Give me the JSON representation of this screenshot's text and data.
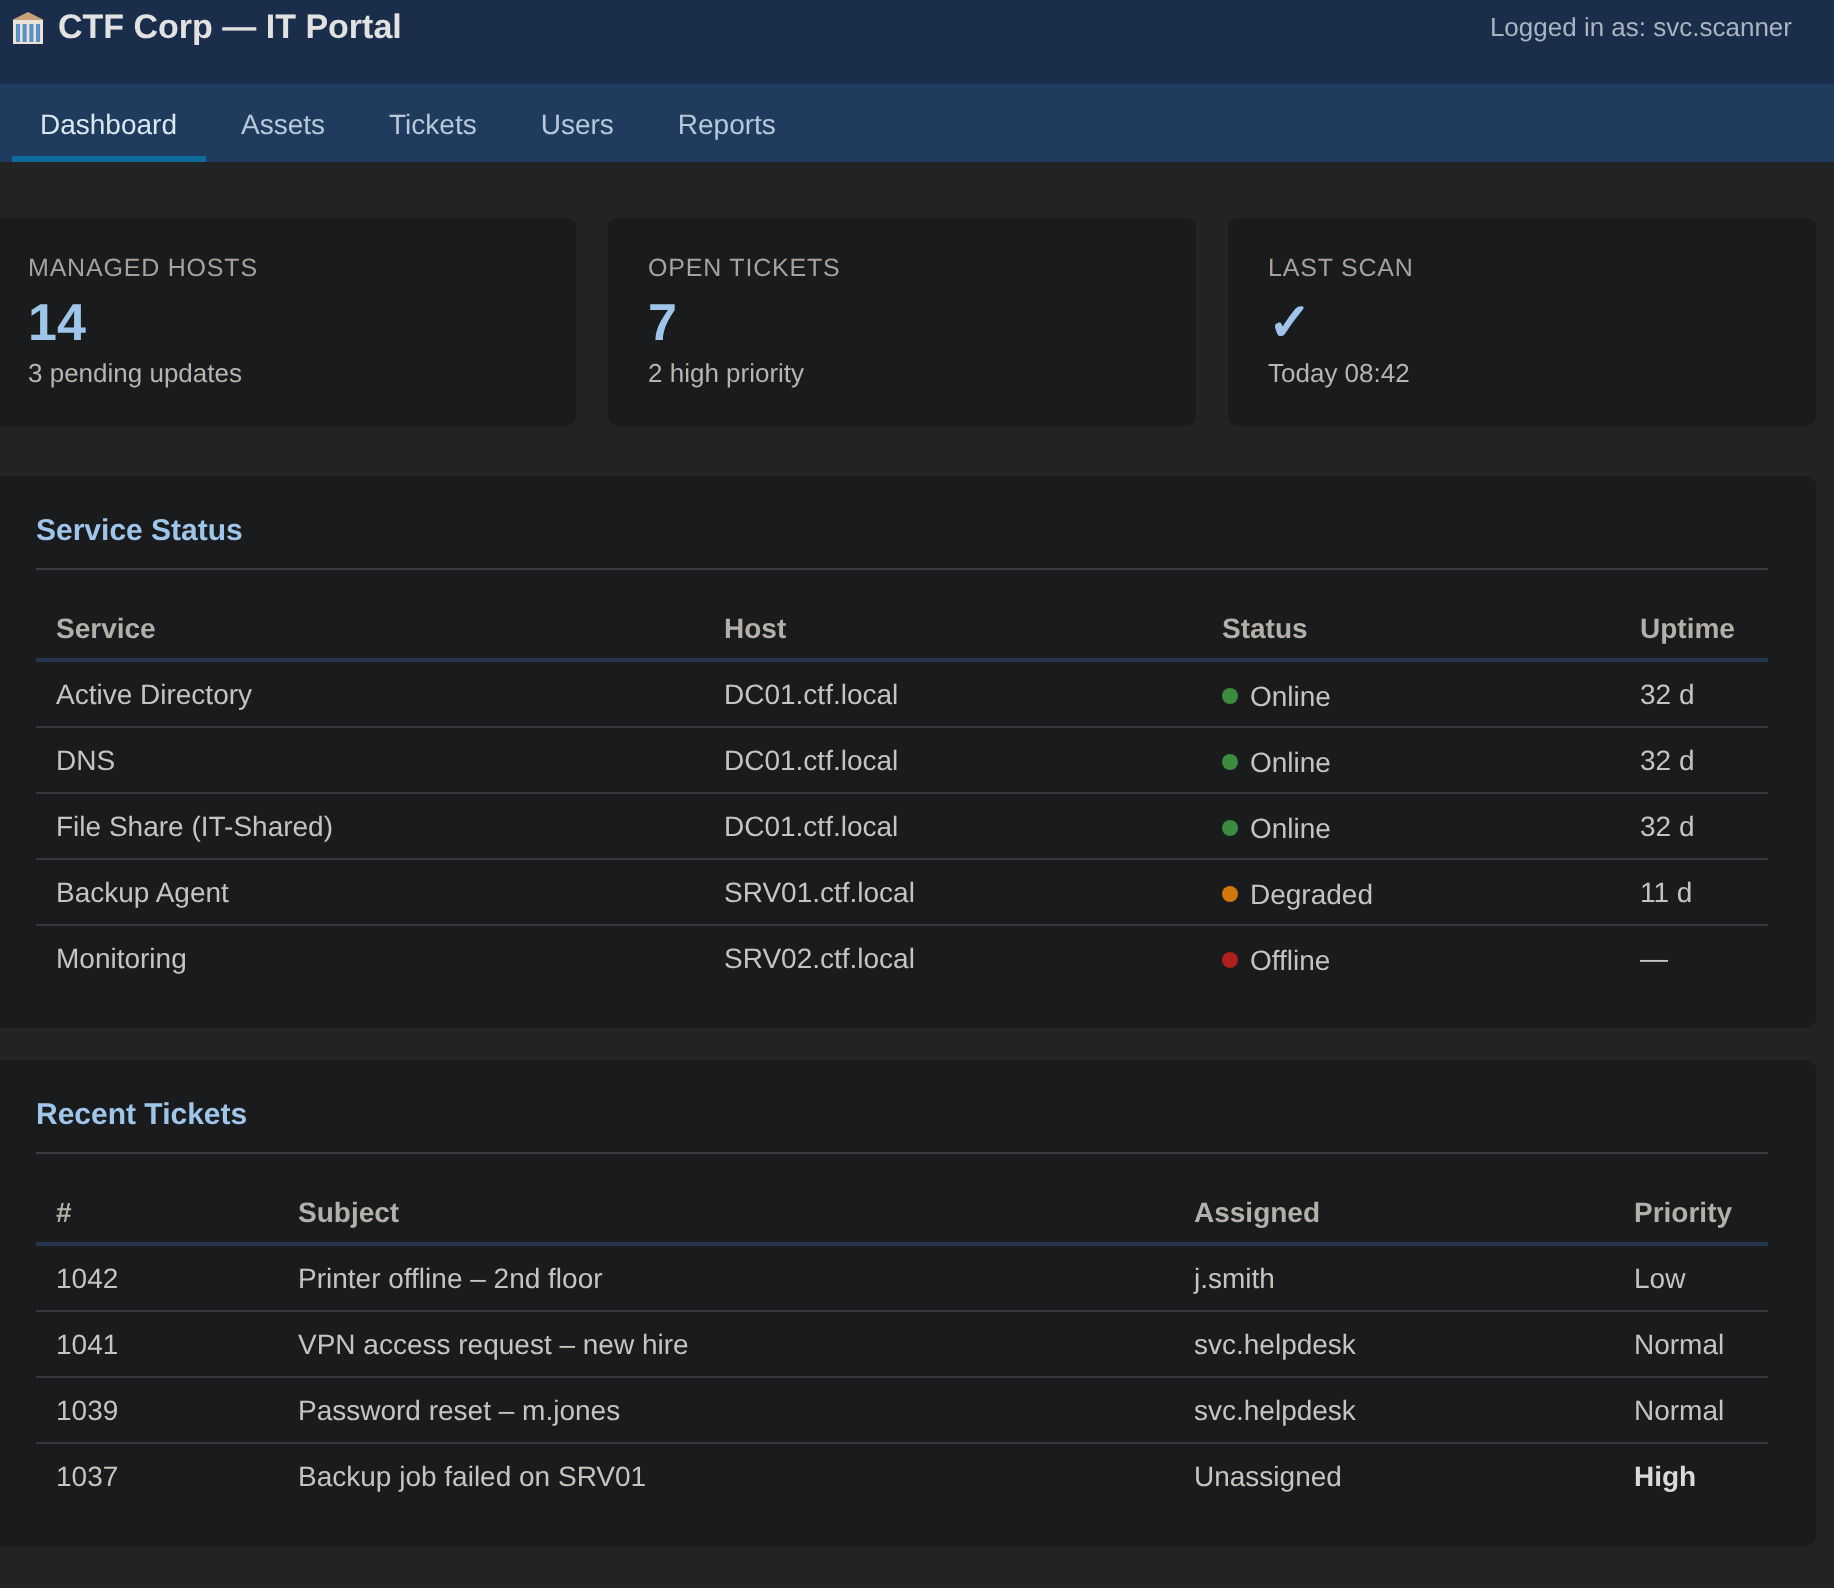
{
  "header": {
    "title": "CTF Corp — IT Portal",
    "user": "Logged in as: svc.scanner"
  },
  "nav": {
    "tabs": [
      {
        "label": "Dashboard",
        "selected": true
      },
      {
        "label": "Assets",
        "selected": false
      },
      {
        "label": "Tickets",
        "selected": false
      },
      {
        "label": "Users",
        "selected": false
      },
      {
        "label": "Reports",
        "selected": false
      }
    ]
  },
  "stats": [
    {
      "label": "MANAGED HOSTS",
      "value": "14",
      "detail": "3 pending updates"
    },
    {
      "label": "OPEN TICKETS",
      "value": "7",
      "detail": "2 high priority"
    },
    {
      "label": "LAST SCAN",
      "value": "✓",
      "detail": "Today 08:42"
    }
  ],
  "services": {
    "title": "Service Status",
    "columns": [
      "Service",
      "Host",
      "Status",
      "Uptime"
    ],
    "rows": [
      {
        "service": "Active Directory",
        "host": "DC01.ctf.local",
        "status": "Online",
        "color": "#3c8c3f",
        "uptime": "32 d"
      },
      {
        "service": "DNS",
        "host": "DC01.ctf.local",
        "status": "Online",
        "color": "#3c8c3f",
        "uptime": "32 d"
      },
      {
        "service": "File Share (IT-Shared)",
        "host": "DC01.ctf.local",
        "status": "Online",
        "color": "#3c8c3f",
        "uptime": "32 d"
      },
      {
        "service": "Backup Agent",
        "host": "SRV01.ctf.local",
        "status": "Degraded",
        "color": "#d4780e",
        "uptime": "11 d"
      },
      {
        "service": "Monitoring",
        "host": "SRV02.ctf.local",
        "status": "Offline",
        "color": "#b01e1e",
        "uptime": "—"
      }
    ]
  },
  "tickets": {
    "title": "Recent Tickets",
    "columns": [
      "#",
      "Subject",
      "Assigned",
      "Priority"
    ],
    "rows": [
      {
        "id": "1042",
        "subject": "Printer offline – 2nd floor",
        "assigned": "j.smith",
        "priority": "Low",
        "emphasized": false
      },
      {
        "id": "1041",
        "subject": "VPN access request – new hire",
        "assigned": "svc.helpdesk",
        "priority": "Normal",
        "emphasized": false
      },
      {
        "id": "1039",
        "subject": "Password reset – m.jones",
        "assigned": "svc.helpdesk",
        "priority": "Normal",
        "emphasized": false
      },
      {
        "id": "1037",
        "subject": "Backup job failed on SRV01",
        "assigned": "Unassigned",
        "priority": "High",
        "emphasized": true
      }
    ]
  }
}
